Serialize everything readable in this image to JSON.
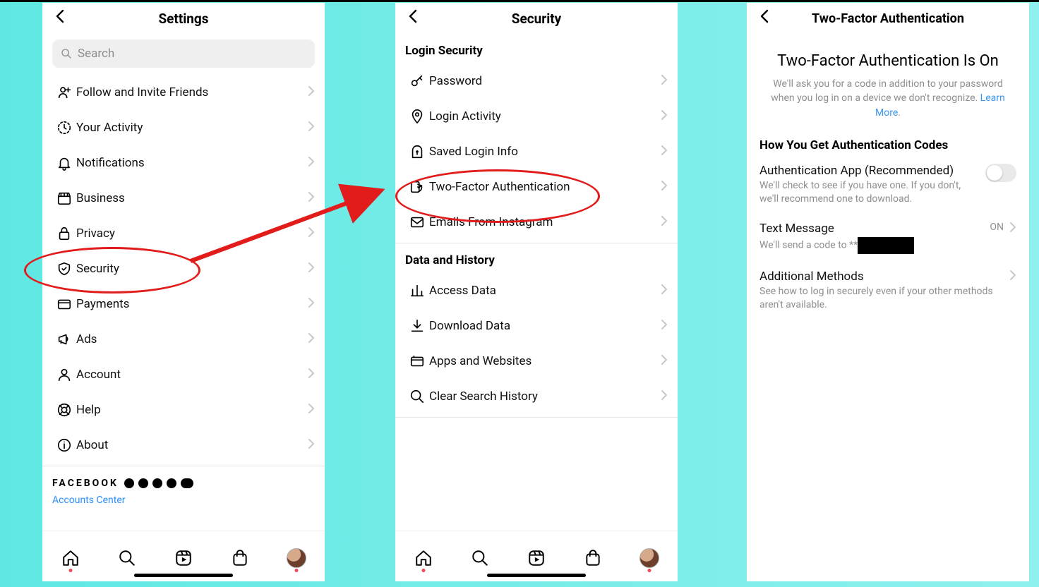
{
  "panel1": {
    "title": "Settings",
    "search_placeholder": "Search",
    "items": [
      {
        "label": "Follow and Invite Friends",
        "icon": "invite"
      },
      {
        "label": "Your Activity",
        "icon": "activity"
      },
      {
        "label": "Notifications",
        "icon": "bell"
      },
      {
        "label": "Business",
        "icon": "shop"
      },
      {
        "label": "Privacy",
        "icon": "lock"
      },
      {
        "label": "Security",
        "icon": "shield"
      },
      {
        "label": "Payments",
        "icon": "card"
      },
      {
        "label": "Ads",
        "icon": "megaphone"
      },
      {
        "label": "Account",
        "icon": "person"
      },
      {
        "label": "Help",
        "icon": "help"
      },
      {
        "label": "About",
        "icon": "info"
      }
    ],
    "facebook_label": "FACEBOOK",
    "accounts_center": "Accounts Center"
  },
  "panel2": {
    "title": "Security",
    "sections": [
      {
        "title": "Login Security",
        "items": [
          {
            "label": "Password",
            "icon": "key"
          },
          {
            "label": "Login Activity",
            "icon": "pin"
          },
          {
            "label": "Saved Login Info",
            "icon": "keyhole"
          },
          {
            "label": "Two-Factor Authentication",
            "icon": "shield2"
          },
          {
            "label": "Emails From Instagram",
            "icon": "mail"
          }
        ]
      },
      {
        "title": "Data and History",
        "items": [
          {
            "label": "Access Data",
            "icon": "bars"
          },
          {
            "label": "Download Data",
            "icon": "download"
          },
          {
            "label": "Apps and Websites",
            "icon": "apps"
          },
          {
            "label": "Clear Search History",
            "icon": "searchx"
          }
        ]
      }
    ]
  },
  "panel3": {
    "title": "Two-Factor Authentication",
    "heading": "Two-Factor Authentication Is On",
    "subtext": "We'll ask you for a code in addition to your password when you log in on a device we don't recognize. ",
    "learn_more": "Learn More",
    "section_title": "How You Get Authentication Codes",
    "options": [
      {
        "title": "Authentication App (Recommended)",
        "desc": "We'll check to see if you have one. If you don't, we'll recommend one to download.",
        "ctrl": "switch"
      },
      {
        "title": "Text Message",
        "desc": "We'll send a code to **",
        "ctrl": "on",
        "state": "ON"
      },
      {
        "title": "Additional Methods",
        "desc": "See how to log in securely even if your other methods aren't available.",
        "ctrl": "chev"
      }
    ]
  }
}
